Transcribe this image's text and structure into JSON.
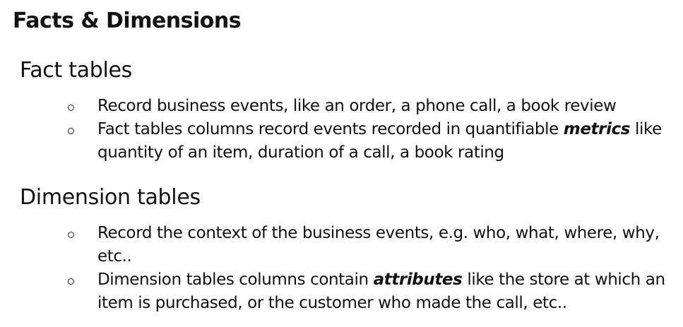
{
  "title": "Facts & Dimensions",
  "sections": [
    {
      "heading": "Fact tables",
      "bullets": [
        {
          "before": "Record business events, like an order, a phone call, a book review",
          "emphasis": "",
          "after": ""
        },
        {
          "before": "Fact tables columns record events recorded in quantifiable ",
          "emphasis": "metrics",
          "after": " like quantity of an item, duration of a call, a book rating"
        }
      ]
    },
    {
      "heading": "Dimension tables",
      "bullets": [
        {
          "before": "Record the context of the business events, e.g. who, what, where, why, etc..",
          "emphasis": "",
          "after": ""
        },
        {
          "before": "Dimension tables columns contain ",
          "emphasis": "attributes",
          "after": " like the store at which an item is purchased, or the customer who made the call, etc.."
        }
      ]
    }
  ]
}
